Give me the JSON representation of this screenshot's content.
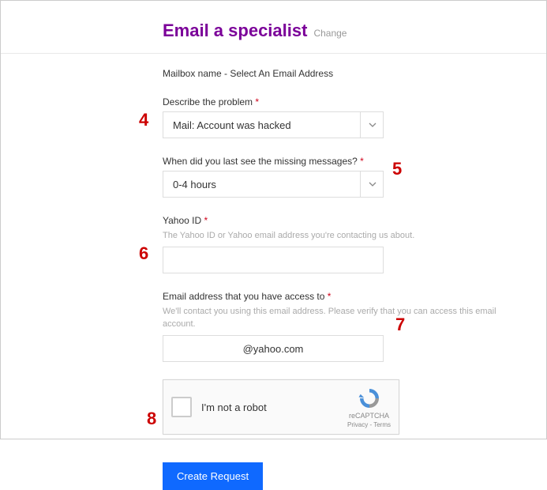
{
  "header": {
    "title": "Email a specialist",
    "change_label": "Change"
  },
  "mailbox_text": "Mailbox name - Select An Email Address",
  "fields": {
    "problem": {
      "label": "Describe the problem",
      "value": "Mail: Account was hacked"
    },
    "lastseen": {
      "label": "When did you last see the missing messages?",
      "value": "0-4 hours"
    },
    "yahooid": {
      "label": "Yahoo ID",
      "help": "The Yahoo ID or Yahoo email address you're contacting us about.",
      "value": ""
    },
    "email": {
      "label": "Email address that you have access to",
      "help": "We'll contact you using this email address. Please verify that you can access this email account.",
      "value": "@yahoo.com"
    }
  },
  "recaptcha": {
    "label": "I'm not a robot",
    "brand": "reCAPTCHA",
    "links": "Privacy - Terms"
  },
  "submit_label": "Create Request",
  "annotations": {
    "n4": "4",
    "n5": "5",
    "n6": "6",
    "n7": "7",
    "n8": "8"
  }
}
